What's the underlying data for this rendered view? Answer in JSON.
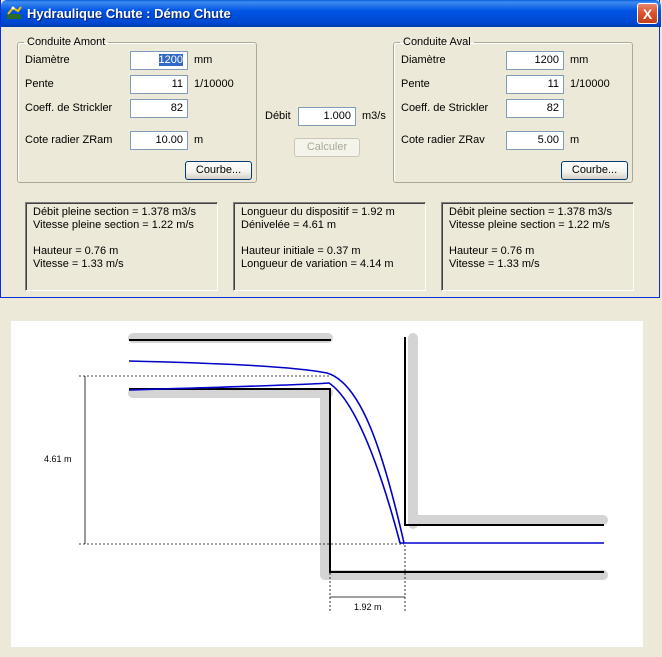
{
  "window": {
    "title": "Hydraulique Chute : Démo Chute",
    "close_label": "X"
  },
  "amont": {
    "legend": "Conduite Amont",
    "diametre_label": "Diamètre",
    "diametre_value": "1200",
    "diametre_unit": "mm",
    "pente_label": "Pente",
    "pente_value": "11",
    "pente_unit": "1/10000",
    "strickler_label": "Coeff.  de Strickler",
    "strickler_value": "82",
    "cote_label": "Cote radier ZRam",
    "cote_value": "10.00",
    "cote_unit": "m",
    "courbe_label": "Courbe..."
  },
  "aval": {
    "legend": "Conduite Aval",
    "diametre_label": "Diamètre",
    "diametre_value": "1200",
    "diametre_unit": "mm",
    "pente_label": "Pente",
    "pente_value": "11",
    "pente_unit": "1/10000",
    "strickler_label": "Coeff.  de Strickler",
    "strickler_value": "82",
    "cote_label": "Cote radier ZRav",
    "cote_value": "5.00",
    "cote_unit": "m",
    "courbe_label": "Courbe..."
  },
  "debit": {
    "label": "Débit",
    "value": "1.000",
    "unit": "m3/s",
    "calculer_label": "Calculer"
  },
  "results": {
    "amont": {
      "line1": "Débit pleine section = 1.378 m3/s",
      "line2": "Vitesse pleine section = 1.22 m/s",
      "line3": "Hauteur  = 0.76 m",
      "line4": "Vitesse = 1.33 m/s"
    },
    "dispositif": {
      "line1": "Longueur du dispositif = 1.92 m",
      "line2": "Dénivelée = 4.61 m",
      "line3": "Hauteur initiale = 0.37 m",
      "line4": "Longueur de variation = 4.14 m"
    },
    "aval": {
      "line1": "Débit pleine section = 1.378 m3/s",
      "line2": "Vitesse pleine section = 1.22 m/s",
      "line3": "Hauteur  = 0.76 m",
      "line4": "Vitesse = 1.33 m/s"
    }
  },
  "drawing": {
    "height_label": "4.61 m",
    "length_label": "1.92 m",
    "pipe_color": "#000000",
    "shadow_color": "#d4d4d4",
    "water_color": "#0000c8"
  }
}
